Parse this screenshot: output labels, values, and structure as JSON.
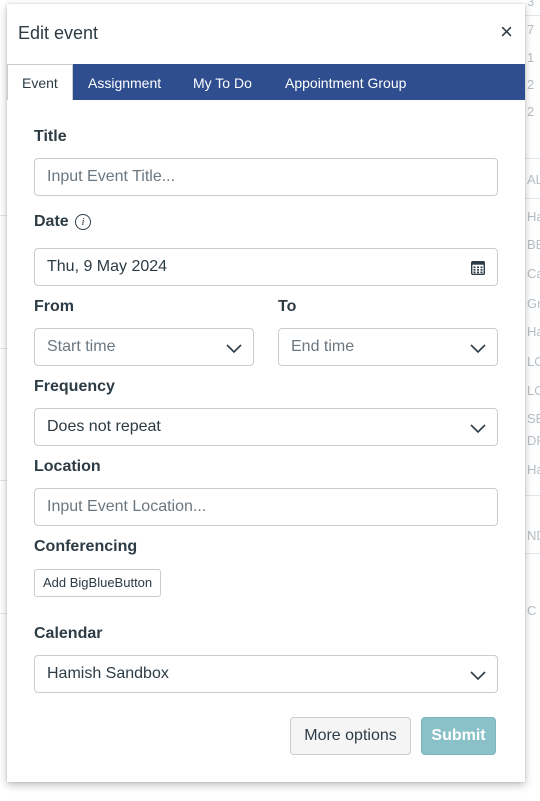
{
  "dialog": {
    "title": "Edit event",
    "close_glyph": "×"
  },
  "tabs": [
    {
      "label": "Event"
    },
    {
      "label": "Assignment"
    },
    {
      "label": "My To Do"
    },
    {
      "label": "Appointment Group"
    }
  ],
  "form": {
    "title_label": "Title",
    "title_placeholder": "Input Event Title...",
    "date_label": "Date",
    "date_value": "Thu, 9 May 2024",
    "from_label": "From",
    "from_placeholder": "Start time",
    "to_label": "To",
    "to_placeholder": "End time",
    "frequency_label": "Frequency",
    "frequency_value": "Does not repeat",
    "location_label": "Location",
    "location_placeholder": "Input Event Location...",
    "conferencing_label": "Conferencing",
    "conferencing_button": "Add BigBlueButton",
    "calendar_label": "Calendar",
    "calendar_value": "Hamish Sandbox"
  },
  "footer": {
    "more_options": "More options",
    "submit": "Submit"
  },
  "background_fragments": [
    "3",
    "7",
    "1",
    "2",
    "2",
    "AL",
    "Ha",
    "BB",
    "Cat",
    "Gro",
    "Ha",
    "LO",
    "LO",
    "SB",
    "DR",
    "Har",
    "ND",
    "C"
  ],
  "colors": {
    "tab_bar": "#2f4e8f",
    "submit_bg": "#8ac0c8",
    "text": "#2d3b45"
  }
}
